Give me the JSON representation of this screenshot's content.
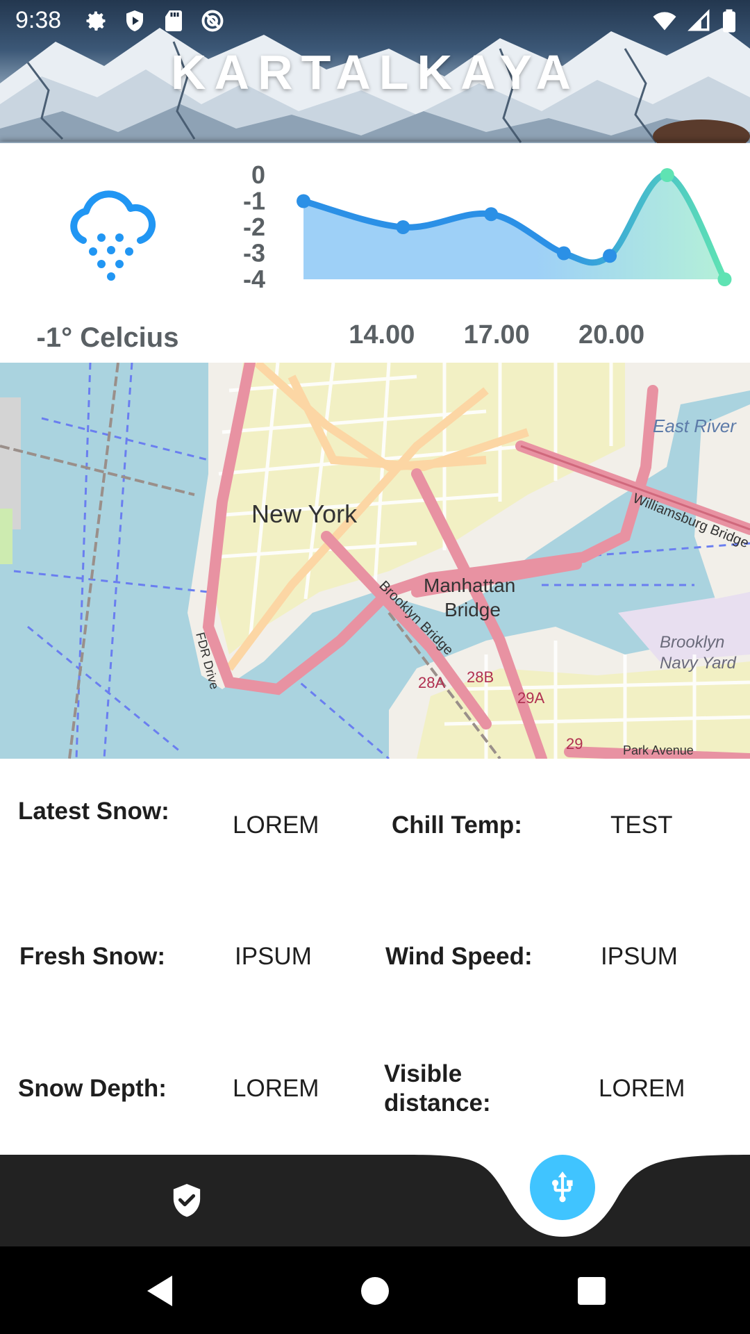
{
  "status_bar": {
    "time": "9:38",
    "left_icons": [
      "gear-icon",
      "play-protect-icon",
      "sd-card-icon",
      "at-sign-icon"
    ],
    "right_icons": [
      "wifi-icon",
      "cell-signal-icon",
      "battery-icon"
    ]
  },
  "header": {
    "title": "KARTALKAYA"
  },
  "weather": {
    "icon": "snow-cloud-icon",
    "temperature": "-1° Celcius"
  },
  "chart_data": {
    "type": "area",
    "y_ticks": [
      "0",
      "-1",
      "-2",
      "-3",
      "-4"
    ],
    "x_ticks": [
      "14.00",
      "17.00",
      "20.00"
    ],
    "ylim": [
      -4,
      0
    ],
    "x": [
      11.9,
      14.5,
      16.8,
      18.7,
      19.9,
      21.4,
      22.9
    ],
    "y": [
      -1.0,
      -2.0,
      -1.5,
      -3.0,
      -3.1,
      0.0,
      -4.0
    ],
    "colors": {
      "line_start": "#2b90e6",
      "line_end": "#5fe3b3",
      "fill_start": "#9ed0f7",
      "fill_end": "#b4f0d8"
    }
  },
  "map": {
    "labels": [
      "New York",
      "Manhattan",
      "Bridge",
      "East River",
      "Brooklyn",
      "Navy Yard",
      "Brooklyn Bridge",
      "Williamsburg Bridge",
      "FDR Drive",
      "Park Avenue",
      "28A",
      "28B",
      "29A",
      "29"
    ]
  },
  "info": {
    "latest_snow_label": "Latest Snow:",
    "latest_snow_value": "LOREM",
    "chill_temp_label": "Chill Temp:",
    "chill_temp_value": "TEST",
    "fresh_snow_label": "Fresh Snow:",
    "fresh_snow_value": "IPSUM",
    "wind_speed_label": "Wind Speed:",
    "wind_speed_value": "IPSUM",
    "snow_depth_label": "Snow Depth:",
    "snow_depth_value": "LOREM",
    "visible_distance_label": "Visible distance:",
    "visible_distance_value": "LOREM"
  },
  "bottom_nav": {
    "left_icon": "shield-check-icon",
    "fab_icon": "usb-icon",
    "fab_color": "#40c4ff",
    "bar_color": "#222222"
  },
  "system_nav": {
    "icons": [
      "back-icon",
      "home-icon",
      "recents-icon"
    ]
  }
}
